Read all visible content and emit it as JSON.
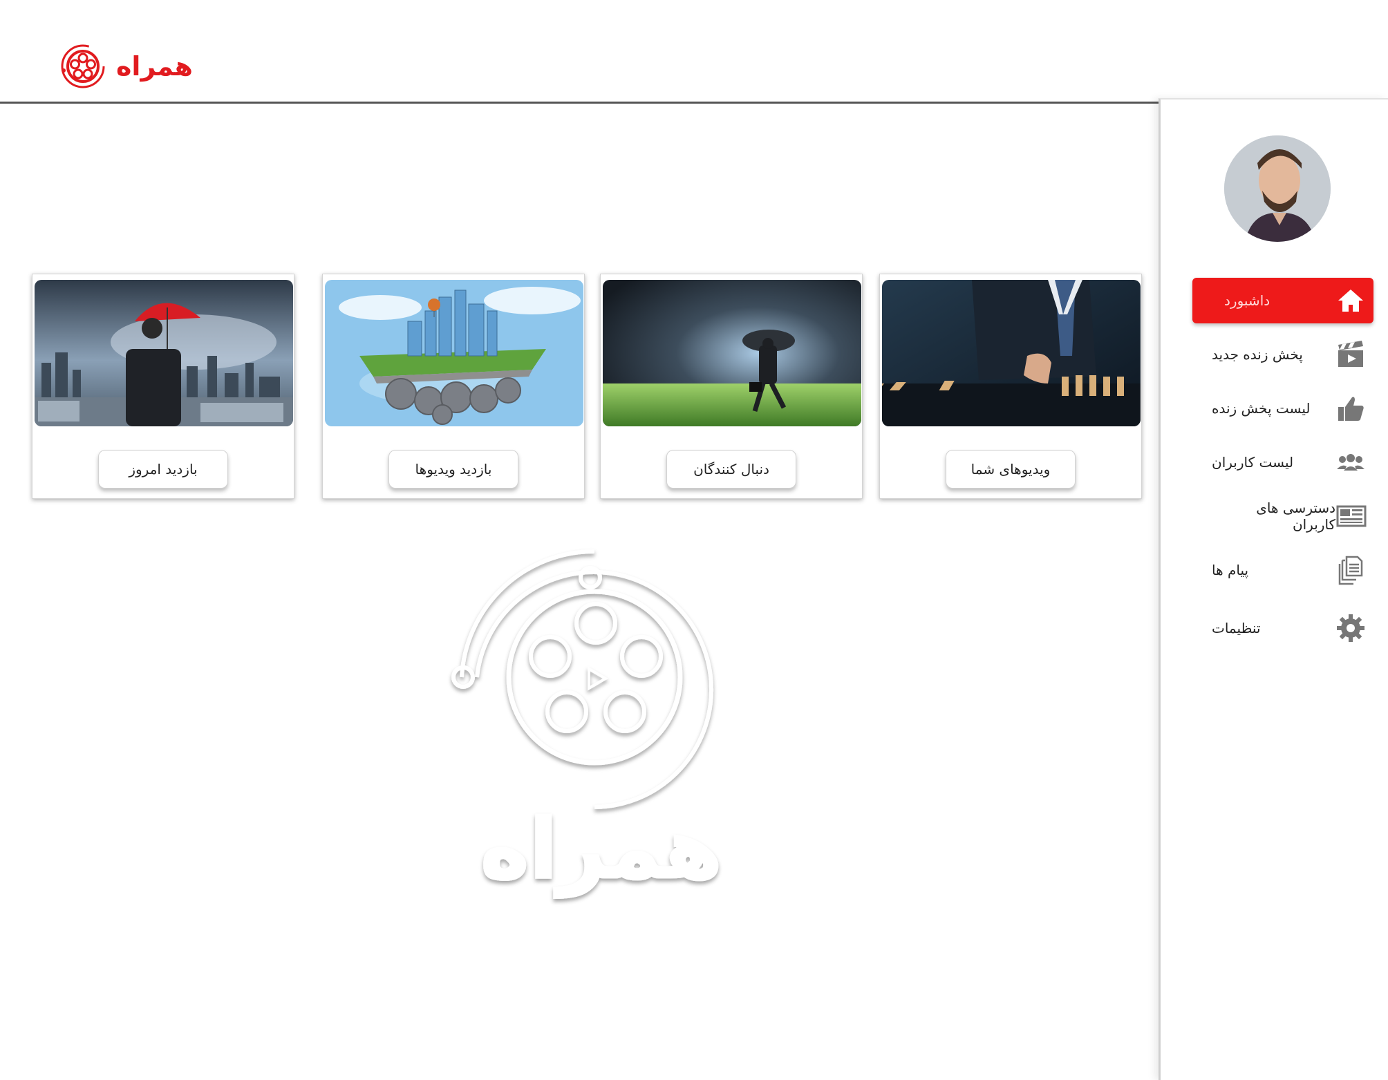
{
  "header": {
    "brand_name": "همراه",
    "brand_color": "#e11b1f"
  },
  "sidebar": {
    "avatar_icon": "user-avatar",
    "items": [
      {
        "label": "داشبورد",
        "icon": "home-icon",
        "active": true
      },
      {
        "label": "پخش زنده جدید",
        "icon": "clapperboard-icon",
        "active": false
      },
      {
        "label": "لیست پخش زنده",
        "icon": "thumbs-up-icon",
        "active": false
      },
      {
        "label": "لیست کاربران",
        "icon": "users-icon",
        "active": false
      },
      {
        "label": "دسترسی های کاربران",
        "icon": "user-access-icon",
        "active": false
      },
      {
        "label": "پیام ها",
        "icon": "documents-icon",
        "active": false
      },
      {
        "label": "تنظیمات",
        "icon": "gear-icon",
        "active": false
      }
    ],
    "active_color": "#ee1a1a"
  },
  "cards": [
    {
      "button_label": "ویدیوهای شما",
      "image": "businessman-stopping-dominoes"
    },
    {
      "button_label": "دنبال کنندگان",
      "image": "businessman-walking-in-storm"
    },
    {
      "button_label": "بازدید ویدیوها",
      "image": "city-on-gears-island"
    },
    {
      "button_label": "بازدید امروز",
      "image": "businessman-with-red-umbrella"
    }
  ],
  "watermark": {
    "brand_name": "همراه"
  }
}
